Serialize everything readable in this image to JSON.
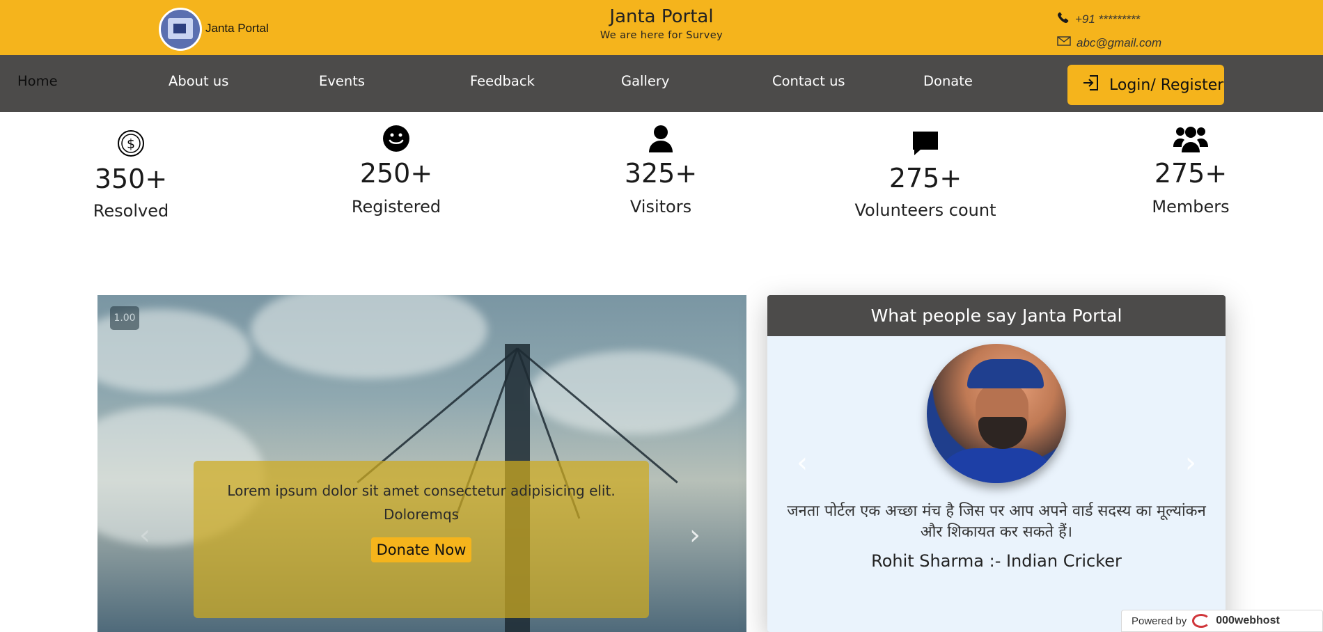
{
  "header": {
    "logo_text": "Janta Portal",
    "title": "Janta Portal",
    "subtitle": "We are here for Survey",
    "phone": "+91 *********",
    "email": "abc@gmail.com"
  },
  "nav": {
    "items": [
      "Home",
      "About us",
      "Events",
      "Feedback",
      "Gallery",
      "Contact us",
      "Donate"
    ],
    "login_label": "Login/ Register"
  },
  "stats": [
    {
      "icon": "dollar-icon",
      "value": "350+",
      "label": "Resolved"
    },
    {
      "icon": "smile-icon",
      "value": "250+",
      "label": "Registered"
    },
    {
      "icon": "person-icon",
      "value": "325+",
      "label": "Visitors"
    },
    {
      "icon": "chat-icon",
      "value": "275+",
      "label": "Volunteers count"
    },
    {
      "icon": "people-icon",
      "value": "275+",
      "label": "Members"
    }
  ],
  "hero": {
    "badge": "1.00",
    "caption": "Lorem ipsum dolor sit amet consectetur adipisicing elit. Doloremqs",
    "donate_label": "Donate Now"
  },
  "testimonial": {
    "heading": "What people say Janta Portal",
    "quote": "जनता पोर्टल एक अच्छा मंच है जिस पर आप अपने वार्ड सदस्य का मूल्यांकन और शिकायत कर सकते हैं।",
    "author": "Rohit Sharma :- Indian Cricker"
  },
  "footer": {
    "powered_by": "Powered by",
    "host": "000webhost"
  },
  "colors": {
    "accent": "#f5b41c",
    "nav_bg": "#4c4b4a",
    "testimonial_bg": "#eaf3fc"
  }
}
